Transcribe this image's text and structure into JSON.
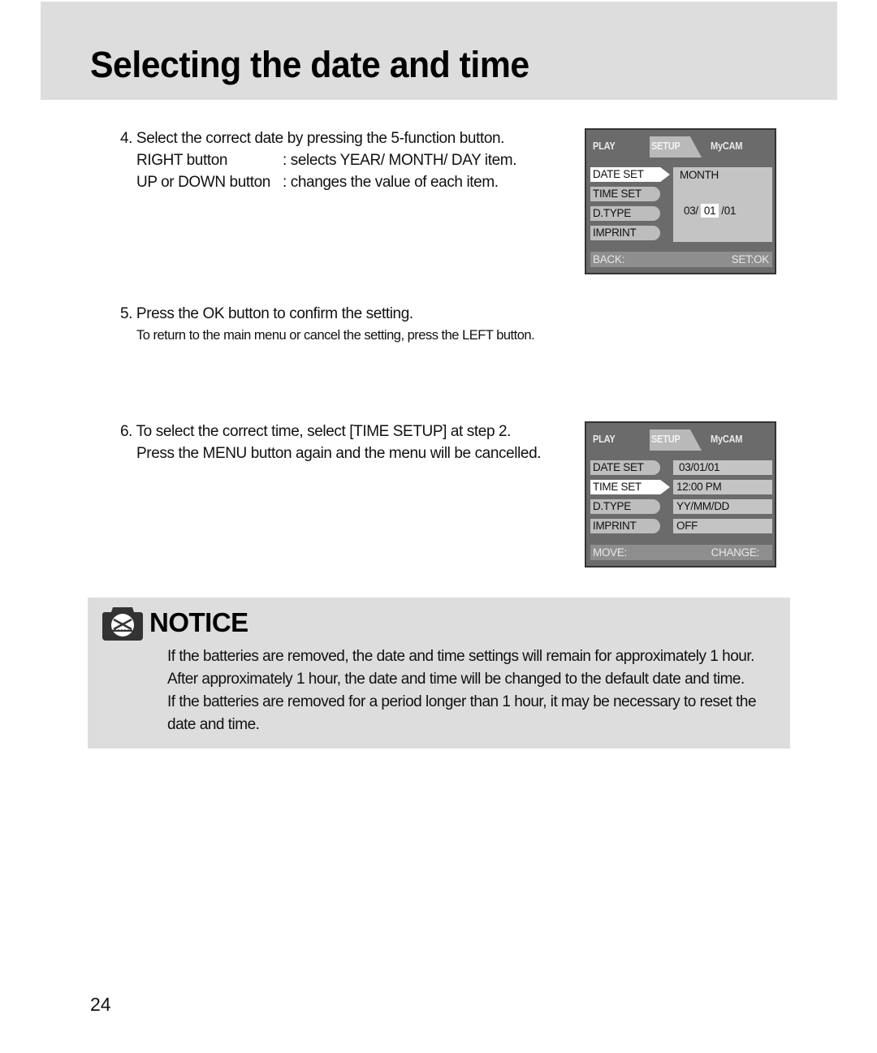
{
  "page": {
    "title": "Selecting the date and time",
    "page_number": "24"
  },
  "steps": {
    "step4": {
      "heading": "4. Select the correct date by pressing the 5-function button.",
      "rows": [
        {
          "key": "RIGHT button",
          "value": ": selects YEAR/ MONTH/ DAY item."
        },
        {
          "key": "UP or DOWN button",
          "value": ": changes the value of each item."
        }
      ]
    },
    "step5": {
      "heading": "5. Press the OK button to confirm the setting.",
      "note": "To return to the main menu or cancel the setting, press the LEFT button."
    },
    "step6": {
      "heading": "6. To select the correct time, select [TIME SETUP] at step 2.",
      "line2": "Press the MENU button again and the menu will be cancelled."
    }
  },
  "lcd1": {
    "tabs": [
      "PLAY",
      "SETUP",
      "MyCAM"
    ],
    "active_tab": "SETUP",
    "menu": [
      "DATE SET",
      "TIME SET",
      "D.TYPE",
      "IMPRINT"
    ],
    "selected_menu": "DATE SET",
    "panel_label": "MONTH",
    "date_parts": {
      "year": "03/",
      "month": "01",
      "day": "/01"
    },
    "footer_left": "BACK:",
    "footer_right": "SET:OK"
  },
  "lcd2": {
    "tabs": [
      "PLAY",
      "SETUP",
      "MyCAM"
    ],
    "active_tab": "SETUP",
    "menu": [
      "DATE SET",
      "TIME SET",
      "D.TYPE",
      "IMPRINT"
    ],
    "selected_menu": "TIME SET",
    "values": [
      "03/01/01",
      "12:00 PM",
      "YY/MM/DD",
      "OFF"
    ],
    "footer_left": "MOVE:",
    "footer_right": "CHANGE:"
  },
  "notice": {
    "icon": "notice-camera-icon",
    "title": "NOTICE",
    "lines": [
      "If the batteries are removed, the date and time settings will remain for approximately 1 hour.",
      "After approximately 1 hour, the date and time will be changed to the default date and time.",
      "If the batteries are removed for a period longer than 1 hour, it may be necessary to reset the",
      "date and time."
    ]
  }
}
